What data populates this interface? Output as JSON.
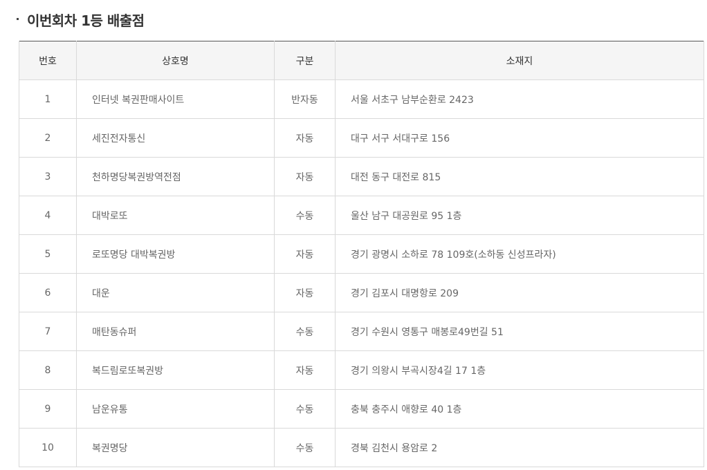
{
  "section": {
    "title": "이번회차 1등 배출점"
  },
  "table": {
    "headers": {
      "no": "번호",
      "name": "상호명",
      "type": "구분",
      "address": "소재지"
    },
    "rows": [
      {
        "no": "1",
        "name": "인터넷 복권판매사이트",
        "type": "반자동",
        "address": "서울 서초구 남부순환로 2423"
      },
      {
        "no": "2",
        "name": "세진전자통신",
        "type": "자동",
        "address": "대구 서구 서대구로 156"
      },
      {
        "no": "3",
        "name": "천하명당복권방역전점",
        "type": "자동",
        "address": "대전 동구 대전로 815"
      },
      {
        "no": "4",
        "name": "대박로또",
        "type": "수동",
        "address": "울산 남구 대공원로 95 1층"
      },
      {
        "no": "5",
        "name": "로또명당 대박복권방",
        "type": "자동",
        "address": "경기 광명시 소하로 78 109호(소하동 신성프라자)"
      },
      {
        "no": "6",
        "name": "대운",
        "type": "자동",
        "address": "경기 김포시 대명항로 209"
      },
      {
        "no": "7",
        "name": "매탄동슈퍼",
        "type": "수동",
        "address": "경기 수원시 영통구 매봉로49번길 51"
      },
      {
        "no": "8",
        "name": "복드림로또복권방",
        "type": "자동",
        "address": "경기 의왕시 부곡시장4길 17 1층"
      },
      {
        "no": "9",
        "name": "남운유통",
        "type": "수동",
        "address": "충북 충주시 애향로 40 1층"
      },
      {
        "no": "10",
        "name": "복권명당",
        "type": "수동",
        "address": "경북 김천시 용암로 2"
      }
    ]
  }
}
